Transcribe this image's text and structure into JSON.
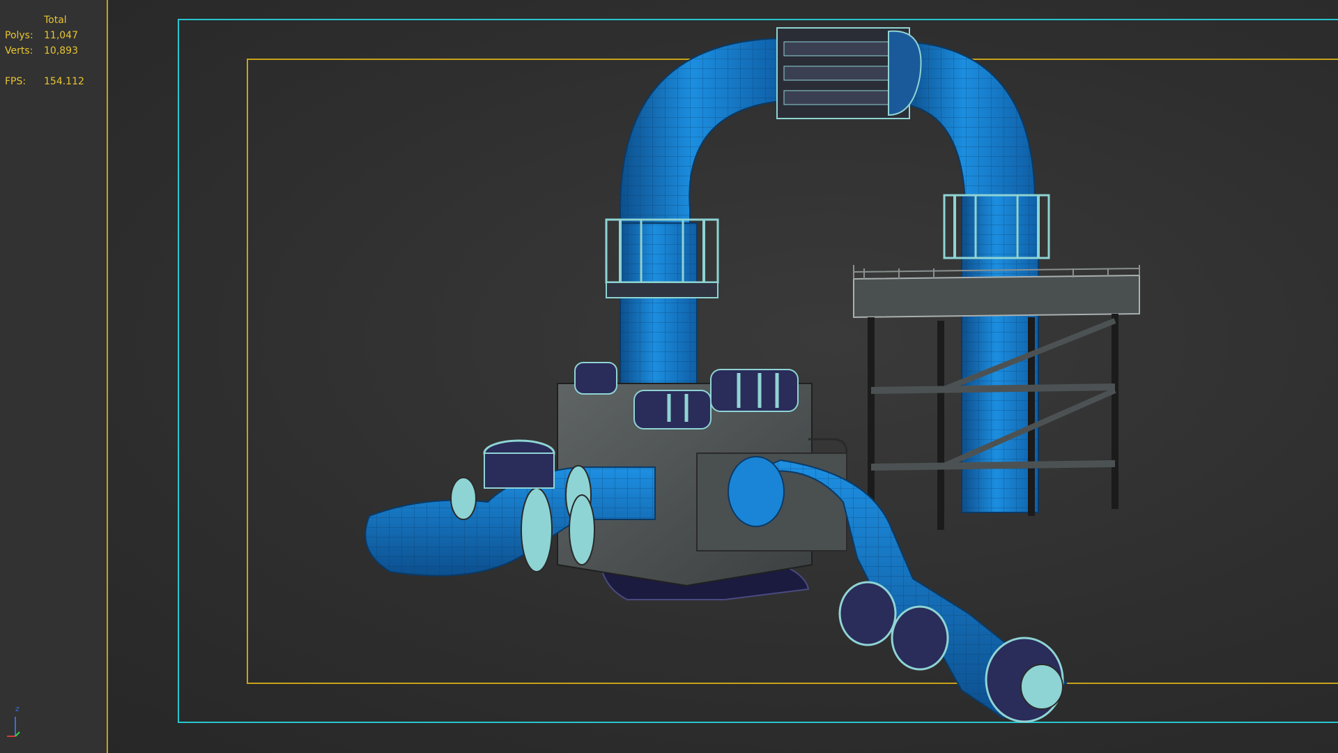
{
  "viewport": {
    "stats": {
      "total_label": "Total",
      "polys_label": "Polys:",
      "polys_value": "11,047",
      "verts_label": "Verts:",
      "verts_value": "10,893",
      "fps_label": "FPS:",
      "fps_value": "154.112"
    },
    "axis": {
      "z_label": "z"
    },
    "colors": {
      "stats_text": "#e8c531",
      "safe_frame_outer": "#27c6cf",
      "safe_frame_inner": "#c9a21a",
      "pipe": "#1a85d6",
      "structure": "#5a5f60",
      "flange": "#8fd4d4"
    }
  }
}
